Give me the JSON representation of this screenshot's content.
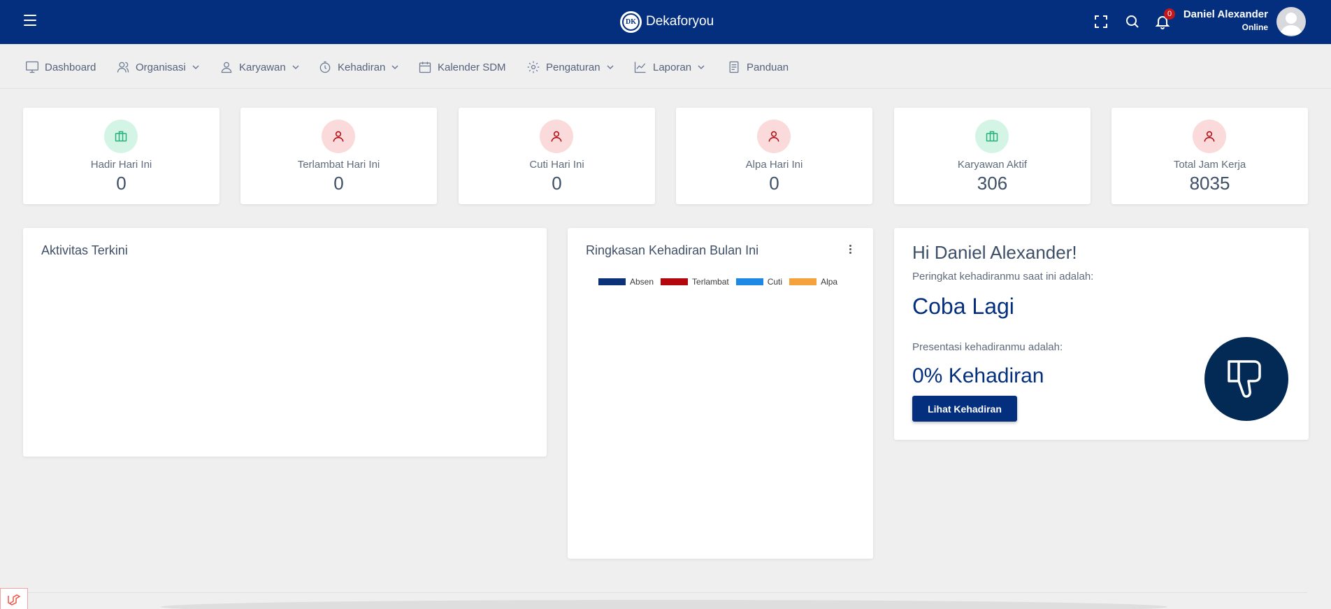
{
  "header": {
    "brand_logo_text": "DK",
    "brand_name": "Dekaforyou",
    "notification_count": "0",
    "user_name": "Daniel Alexander",
    "user_status": "Online"
  },
  "nav": {
    "items": [
      {
        "label": "Dashboard",
        "icon": "monitor-icon",
        "dropdown": false
      },
      {
        "label": "Organisasi",
        "icon": "users-icon",
        "dropdown": true
      },
      {
        "label": "Karyawan",
        "icon": "user-icon",
        "dropdown": true
      },
      {
        "label": "Kehadiran",
        "icon": "stopwatch-icon",
        "dropdown": true
      },
      {
        "label": "Kalender SDM",
        "icon": "calendar-icon",
        "dropdown": false
      },
      {
        "label": "Pengaturan",
        "icon": "gear-icon",
        "dropdown": true
      },
      {
        "label": "Laporan",
        "icon": "line-chart-icon",
        "dropdown": true
      },
      {
        "label": "Panduan",
        "icon": "document-icon",
        "dropdown": false
      }
    ]
  },
  "stats": [
    {
      "label": "Hadir Hari Ini",
      "value": "0",
      "icon": "briefcase-icon",
      "tone": "green"
    },
    {
      "label": "Terlambat Hari Ini",
      "value": "0",
      "icon": "person-icon",
      "tone": "red"
    },
    {
      "label": "Cuti Hari Ini",
      "value": "0",
      "icon": "person-icon",
      "tone": "red"
    },
    {
      "label": "Alpa Hari Ini",
      "value": "0",
      "icon": "person-icon",
      "tone": "red"
    },
    {
      "label": "Karyawan Aktif",
      "value": "306",
      "icon": "briefcase-icon",
      "tone": "green"
    },
    {
      "label": "Total Jam Kerja",
      "value": "8035",
      "icon": "person-icon",
      "tone": "red"
    }
  ],
  "activity": {
    "title": "Aktivitas Terkini"
  },
  "attendance_summary": {
    "title": "Ringkasan Kehadiran Bulan Ini",
    "legend": [
      {
        "label": "Absen",
        "color": "#0b3278"
      },
      {
        "label": "Terlambat",
        "color": "#b3070d"
      },
      {
        "label": "Cuti",
        "color": "#1e88e5"
      },
      {
        "label": "Alpa",
        "color": "#f5a23d"
      }
    ]
  },
  "greeting": {
    "title": "Hi Daniel Alexander!",
    "rank_label": "Peringkat kehadiranmu saat ini adalah:",
    "rank_value": "Coba Lagi",
    "percent_label": "Presentasi kehadiranmu adalah:",
    "percent_value": "0% Kehadiran",
    "button_label": "Lihat Kehadiran",
    "badge_icon": "thumbs-down-icon"
  },
  "colors": {
    "primary": "#032f7e",
    "background": "#efeff0"
  }
}
